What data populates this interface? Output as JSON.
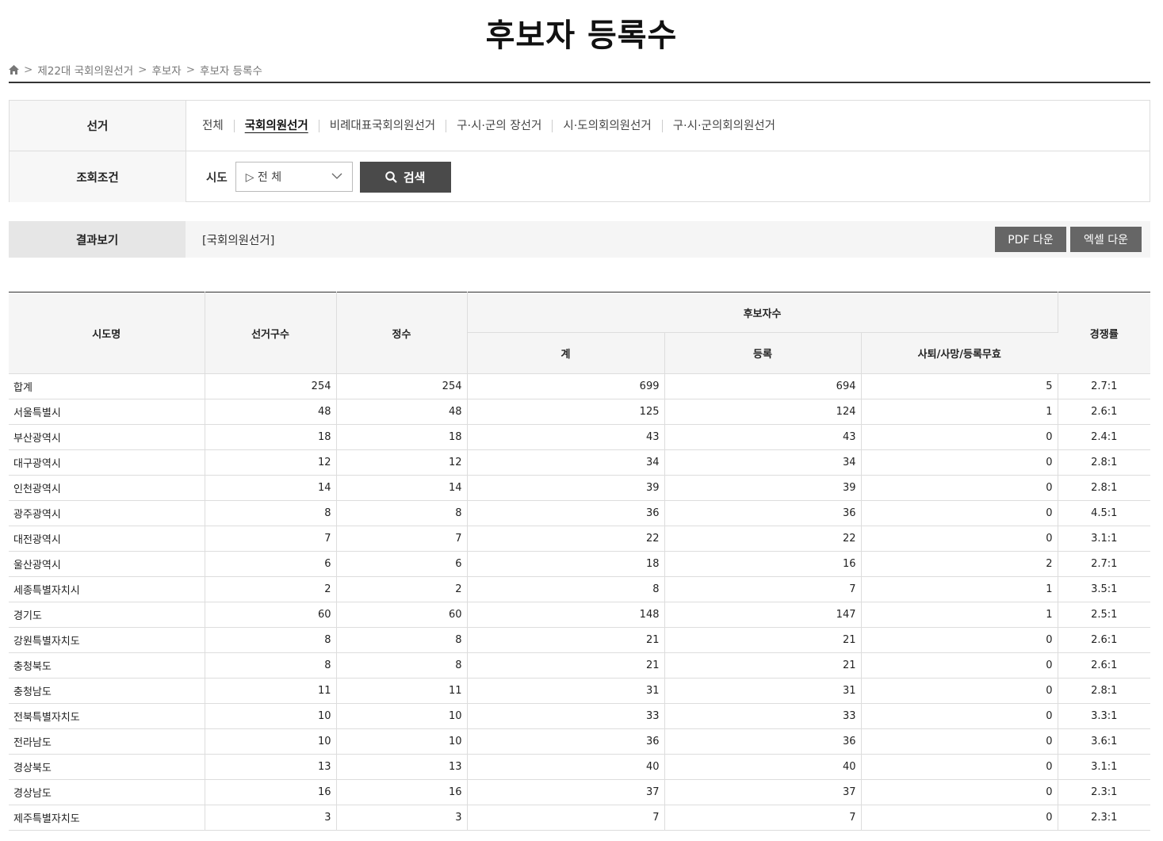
{
  "page_title": "후보자 등록수",
  "breadcrumb": [
    "제22대 국회의원선거",
    "후보자",
    "후보자 등록수"
  ],
  "filter": {
    "election_label": "선거",
    "election_tabs": [
      {
        "label": "전체",
        "active": false
      },
      {
        "label": "국회의원선거",
        "active": true
      },
      {
        "label": "비례대표국회의원선거",
        "active": false
      },
      {
        "label": "구·시·군의 장선거",
        "active": false
      },
      {
        "label": "시·도의회의원선거",
        "active": false
      },
      {
        "label": "구·시·군의회의원선거",
        "active": false
      }
    ],
    "condition_label": "조회조건",
    "sido_label": "시도",
    "sido_value": "▷ 전 체",
    "search_label": "검색"
  },
  "result": {
    "label": "결과보기",
    "text": "[국회의원선거]",
    "pdf_label": "PDF 다운",
    "excel_label": "엑셀 다운"
  },
  "table": {
    "headers": {
      "sido": "시도명",
      "districts": "선거구수",
      "seats": "정수",
      "candidates": "후보자수",
      "total": "계",
      "registered": "등록",
      "withdrawn": "사퇴/사망/등록무효",
      "ratio": "경쟁률"
    },
    "rows": [
      [
        "합계",
        "254",
        "254",
        "699",
        "694",
        "5",
        "2.7:1"
      ],
      [
        "서울특별시",
        "48",
        "48",
        "125",
        "124",
        "1",
        "2.6:1"
      ],
      [
        "부산광역시",
        "18",
        "18",
        "43",
        "43",
        "0",
        "2.4:1"
      ],
      [
        "대구광역시",
        "12",
        "12",
        "34",
        "34",
        "0",
        "2.8:1"
      ],
      [
        "인천광역시",
        "14",
        "14",
        "39",
        "39",
        "0",
        "2.8:1"
      ],
      [
        "광주광역시",
        "8",
        "8",
        "36",
        "36",
        "0",
        "4.5:1"
      ],
      [
        "대전광역시",
        "7",
        "7",
        "22",
        "22",
        "0",
        "3.1:1"
      ],
      [
        "울산광역시",
        "6",
        "6",
        "18",
        "16",
        "2",
        "2.7:1"
      ],
      [
        "세종특별자치시",
        "2",
        "2",
        "8",
        "7",
        "1",
        "3.5:1"
      ],
      [
        "경기도",
        "60",
        "60",
        "148",
        "147",
        "1",
        "2.5:1"
      ],
      [
        "강원특별자치도",
        "8",
        "8",
        "21",
        "21",
        "0",
        "2.6:1"
      ],
      [
        "충청북도",
        "8",
        "8",
        "21",
        "21",
        "0",
        "2.6:1"
      ],
      [
        "충청남도",
        "11",
        "11",
        "31",
        "31",
        "0",
        "2.8:1"
      ],
      [
        "전북특별자치도",
        "10",
        "10",
        "33",
        "33",
        "0",
        "3.3:1"
      ],
      [
        "전라남도",
        "10",
        "10",
        "36",
        "36",
        "0",
        "3.6:1"
      ],
      [
        "경상북도",
        "13",
        "13",
        "40",
        "40",
        "0",
        "3.1:1"
      ],
      [
        "경상남도",
        "16",
        "16",
        "37",
        "37",
        "0",
        "2.3:1"
      ],
      [
        "제주특별자치도",
        "3",
        "3",
        "7",
        "7",
        "0",
        "2.3:1"
      ]
    ]
  }
}
